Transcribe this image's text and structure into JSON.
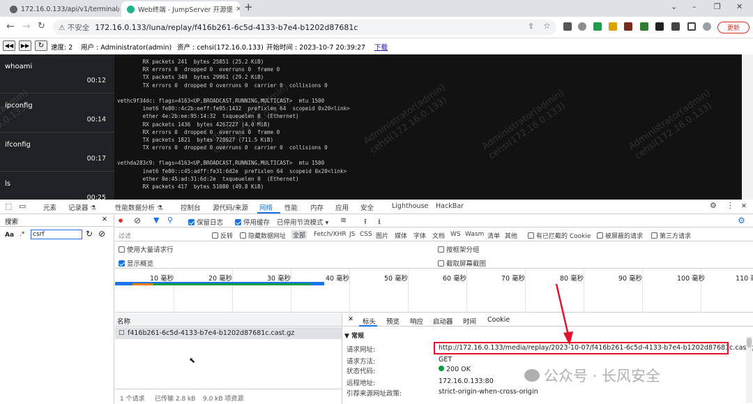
{
  "tabs": [
    {
      "title": "172.16.0.133/api/v1/terminal/s",
      "active": false
    },
    {
      "title": "Web终端 - JumpServer 开源堡",
      "active": true
    }
  ],
  "new_tab": "+",
  "window_controls": {
    "chevron": "⌄",
    "minimize": "–",
    "restore": "❐",
    "close": "✕"
  },
  "address": {
    "security": "⚠ 不安全",
    "url": "172.16.0.133/luna/replay/f416b261-6c5d-4133-b7e4-b1202d87681c",
    "update_label": "更新"
  },
  "player": {
    "speed": "速度: 2",
    "user": "用户 : Administrator(admin)",
    "asset": "资产 : cehsi(172.16.0.133)",
    "start_time": "开始时间 : 2023-10-7 20:39:27",
    "download": "下载"
  },
  "commands": [
    {
      "name": "whoami",
      "time": "00:12"
    },
    {
      "name": "ipconfig",
      "time": "00:14"
    },
    {
      "name": "ifconfig",
      "time": "00:17"
    },
    {
      "name": "ls",
      "time": "00:25"
    }
  ],
  "terminal_lines": [
    "        RX packets 241  bytes 25851 (25.2 KiB)",
    "        RX errors 0  dropped 0  overruns 0  frame 0",
    "        TX packets 349  bytes 29961 (29.2 KiB)",
    "        TX errors 0  dropped 0 overruns 0  carrier 0  collisions 0",
    "",
    "vethc9f34dc: flags=4163<UP,BROADCAST,RUNNING,MULTICAST>  mtu 1500",
    "        inet6 fe80::4c2b:eeff:fe95:1432  prefixlen 64  scopeid 0x20<link>",
    "        ether 4e:2b:ee:95:14:32  txqueuelen 0  (Ethernet)",
    "        RX packets 1436  bytes 4267227 (4.0 MiB)",
    "        RX errors 0  dropped 0  overruns 0  frame 0",
    "        TX packets 1821  bytes 728627 (711.5 KiB)",
    "        TX errors 0  dropped 0 overruns 0  carrier 0  collisions 0",
    "",
    "vethda283c9: flags=4163<UP,BROADCAST,RUNNING,MULTICAST>  mtu 1500",
    "        inet6 fe80::c45:adff:fe31:6d2e  prefixlen 64  scopeid 0x20<link>",
    "        ether 0e:45:ad:31:6d:2e  txqueuelen 0  (Ethernet)",
    "        RX packets 417  bytes 51080 (49.8 KiB)"
  ],
  "watermark": "Administrator(admin)\ncehsi(172.16.0.133)",
  "devtools_tabs": [
    "元素",
    "记录器 ⚗",
    "性能数据分析 ⚗",
    "控制台",
    "源代码/来源",
    "网络",
    "性能",
    "内存",
    "应用",
    "安全",
    "Lighthouse",
    "HackBar"
  ],
  "search": {
    "title": "搜索",
    "aa": "Aa",
    "regex": ".*",
    "query": "csrf"
  },
  "network_toolbar": {
    "preserve_log": "保留日志",
    "disable_cache": "停用缓存",
    "throttle": "已停用节流模式"
  },
  "filter_bar": {
    "placeholder": "过滤",
    "invert": "反转",
    "hide_data_urls": "隐藏数据网址",
    "types": [
      "全部",
      "Fetch/XHR",
      "JS",
      "CSS",
      "图片",
      "媒体",
      "字体",
      "文档",
      "WS",
      "Wasm",
      "清单",
      "其他"
    ],
    "blocked_cookies": "有已拦截的 Cookie",
    "blocked_requests": "被屏蔽的请求",
    "third_party": "第三方请求"
  },
  "options": {
    "large_rows": "使用大量请求行",
    "group_by_frame": "按框架分组",
    "show_overview": "显示概览",
    "capture_screenshots": "截取屏幕截图"
  },
  "timeline_ticks": [
    "10 毫秒",
    "20 毫秒",
    "30 毫秒",
    "40 毫秒",
    "50 毫秒",
    "60 毫秒",
    "70 毫秒",
    "80 毫秒",
    "90 毫秒",
    "100 毫秒",
    "110 毫"
  ],
  "request_list": {
    "header": "名称",
    "items": [
      "f416b261-6c5d-4133-b7e4-b1202d87681c.cast.gz"
    ],
    "status_bar": [
      "1 个请求",
      "已传输 2.8 kB",
      "9.0 kB 项资源"
    ]
  },
  "details": {
    "tabs": [
      "标头",
      "预览",
      "响应",
      "启动器",
      "时间",
      "Cookie"
    ],
    "section": "▼ 常规",
    "rows": [
      {
        "key": "请求网址:",
        "value": "http://172.16.0.133/media/replay/2023-10-07/f416b261-6c5d-4133-b7e4-b1202d87681c.cast.gz"
      },
      {
        "key": "请求方法:",
        "value": "GET"
      },
      {
        "key": "状态代码:",
        "value": "200 OK"
      },
      {
        "key": "远程地址:",
        "value": "172.16.0.133:80"
      },
      {
        "key": "引荐来源网址政策:",
        "value": "strict-origin-when-cross-origin"
      }
    ]
  },
  "wechat_watermark": "公众号 · 长风安全",
  "colors": {
    "accent": "#1a73e8",
    "annotation_red": "#e8112d",
    "terminal_bg": "#121212"
  }
}
